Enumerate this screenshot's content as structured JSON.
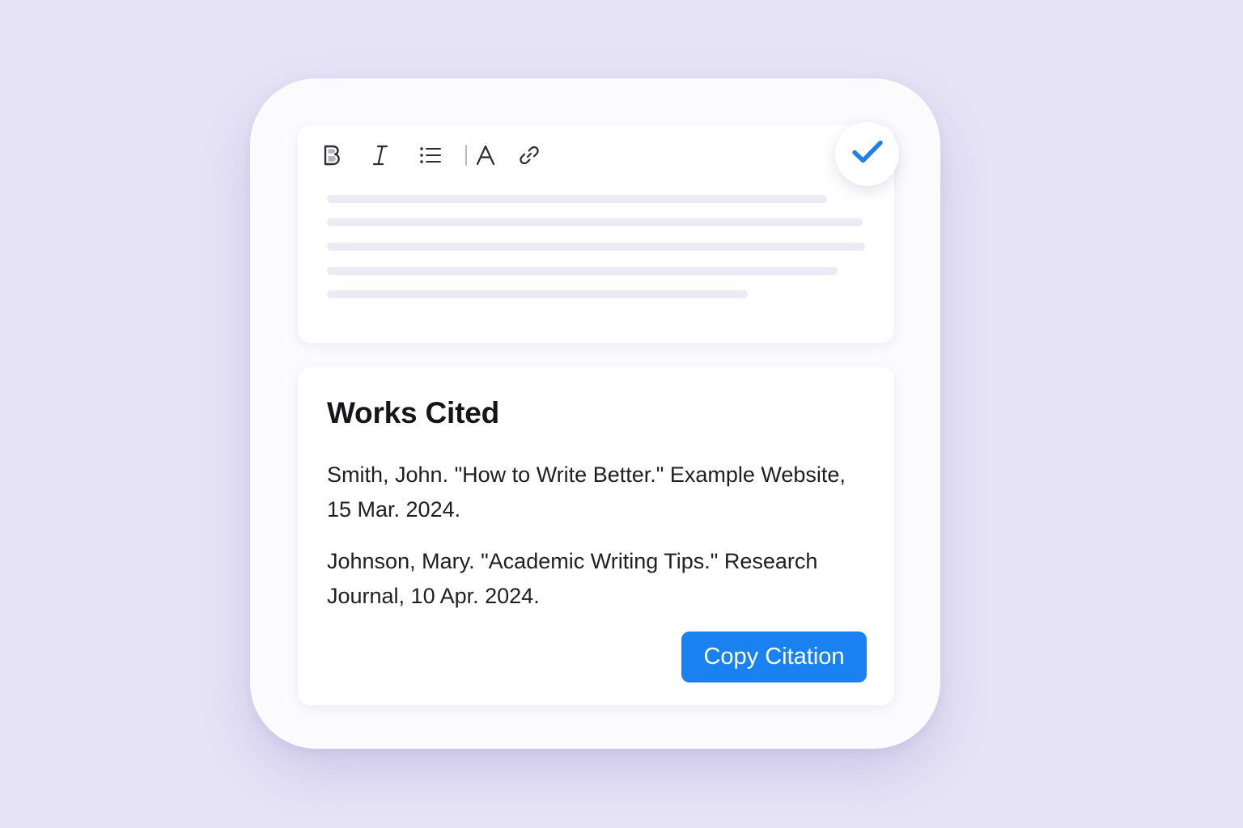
{
  "toolbar": {
    "icons": [
      "bold-icon",
      "italic-icon",
      "bullet-list-icon",
      "font-icon",
      "link-icon"
    ],
    "font_label": "A"
  },
  "confirm": {
    "icon": "check-icon",
    "color": "#1a82f0"
  },
  "citations_panel": {
    "title": "Works Cited",
    "entries": [
      "Smith, John. \"How to Write Better.\" Example Website, 15 Mar. 2024.",
      "Johnson, Mary. \"Academic Writing Tips.\" Research Journal, 10 Apr. 2024."
    ],
    "copy_button_label": "Copy Citation"
  },
  "colors": {
    "background": "#e6e3f6",
    "accent": "#1a82f0",
    "placeholder_line": "#eceaf4"
  }
}
